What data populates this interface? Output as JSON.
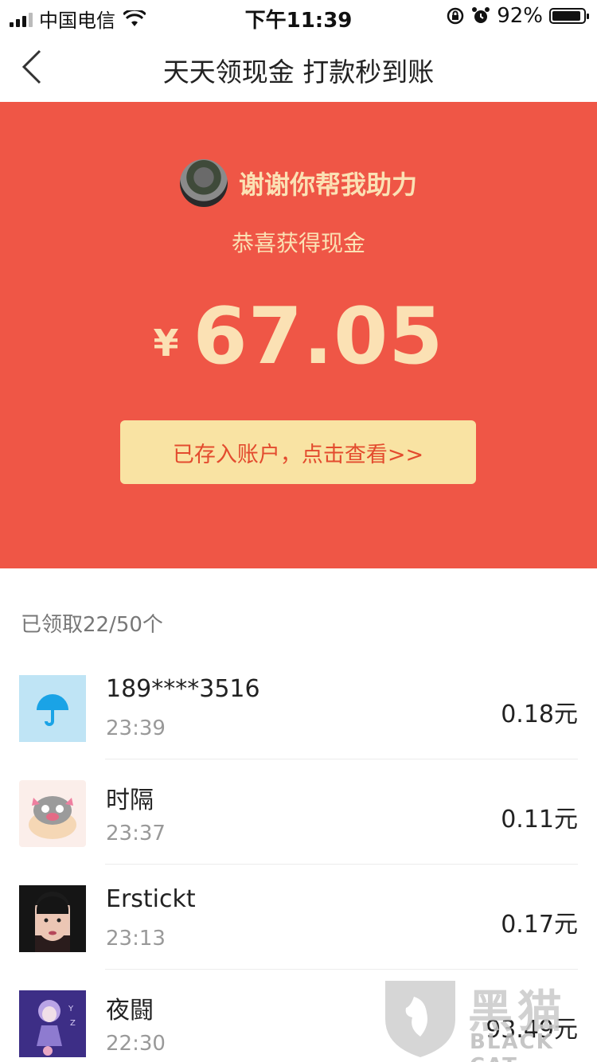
{
  "status_bar": {
    "carrier": "中国电信",
    "time": "下午11:39",
    "battery_percent": "92%",
    "battery_level": 0.92
  },
  "nav": {
    "title": "天天领现金 打款秒到账"
  },
  "header": {
    "helper_text": "谢谢你帮我助力",
    "congrats": "恭喜获得现金",
    "currency": "¥",
    "amount": "67.05",
    "account_button": "已存入账户，点击查看>>"
  },
  "list": {
    "claimed_label": "已领取22/50个",
    "items": [
      {
        "name": "189****3516",
        "time": "23:39",
        "amount": "0.18元"
      },
      {
        "name": "时隔",
        "time": "23:37",
        "amount": "0.11元"
      },
      {
        "name": "Erstickt",
        "time": "23:13",
        "amount": "0.17元"
      },
      {
        "name": "夜闘",
        "time": "22:30",
        "amount": "93.49元"
      }
    ]
  },
  "watermark": {
    "brand_cn": "黑猫",
    "brand_en": "BLACK CAT"
  },
  "colors": {
    "header_red": "#ef5646",
    "gold_text": "#fbe1b4",
    "button_bg": "#f9e3a3",
    "button_text": "#e34b2e"
  }
}
